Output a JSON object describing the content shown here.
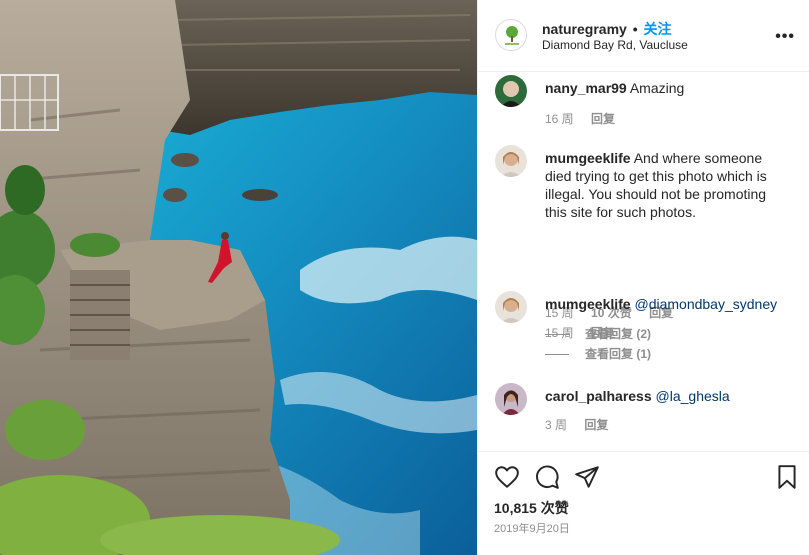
{
  "post": {
    "username": "naturegramy",
    "separator": "•",
    "follow_label": "关注",
    "location": "Diamond Bay Rd, Vaucluse",
    "more_label": "•••"
  },
  "comments": [
    {
      "username": "nany_mar99",
      "text": "Amazing",
      "age": "16 周",
      "reply": "回复"
    },
    {
      "username": "mumgeeklife",
      "text": "And where someone died trying to get this photo which is illegal. You should not be promoting this site for such photos.",
      "age": "15 周",
      "likes": "10 次赞",
      "reply": "回复",
      "view_replies": "查看回复 (2)"
    },
    {
      "username": "mumgeeklife",
      "text": "@diamondbay_sydney",
      "age": "15 周",
      "reply": "回复",
      "view_replies": "查看回复 (1)"
    },
    {
      "username": "carol_palharess",
      "text": "@la_ghesla",
      "age": "3 周",
      "reply": "回复"
    }
  ],
  "actions": {
    "like_icon": "heart-icon",
    "comment_icon": "comment-icon",
    "share_icon": "send-icon",
    "save_icon": "bookmark-icon",
    "likes_count": "10,815 次赞",
    "date": "2019年9月20日"
  },
  "colors": {
    "link": "#0095f6",
    "mention": "#00376b",
    "muted": "#8e8e8e",
    "text": "#262626"
  }
}
